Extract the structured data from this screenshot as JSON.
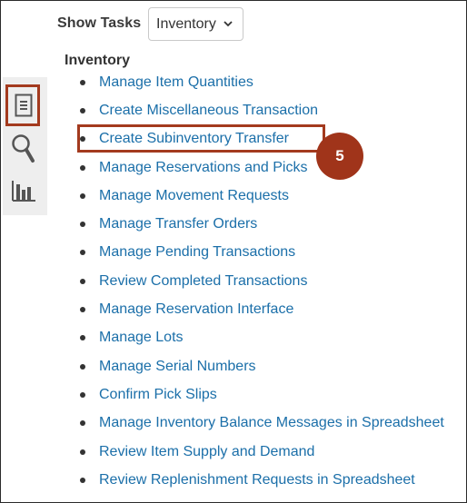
{
  "header": {
    "show_tasks_label": "Show Tasks",
    "selected_option": "Inventory"
  },
  "sidebar": {
    "icons": [
      {
        "name": "tasks-icon"
      },
      {
        "name": "search-icon"
      },
      {
        "name": "reports-icon"
      }
    ]
  },
  "section": {
    "title": "Inventory",
    "items": [
      {
        "label": "Manage Item Quantities"
      },
      {
        "label": "Create Miscellaneous Transaction"
      },
      {
        "label": "Create Subinventory Transfer"
      },
      {
        "label": "Manage Reservations and Picks"
      },
      {
        "label": "Manage Movement Requests"
      },
      {
        "label": "Manage Transfer Orders"
      },
      {
        "label": "Manage Pending Transactions"
      },
      {
        "label": "Review Completed Transactions"
      },
      {
        "label": "Manage Reservation Interface"
      },
      {
        "label": "Manage Lots"
      },
      {
        "label": "Manage Serial Numbers"
      },
      {
        "label": "Confirm Pick Slips"
      },
      {
        "label": "Manage Inventory Balance Messages in Spreadsheet"
      },
      {
        "label": "Review Item Supply and Demand"
      },
      {
        "label": "Review Replenishment Requests in Spreadsheet"
      }
    ]
  },
  "callout": {
    "step_number": "5"
  },
  "colors": {
    "link": "#1b6fa9",
    "highlight": "#a33a1e",
    "badge": "#a0341a"
  }
}
